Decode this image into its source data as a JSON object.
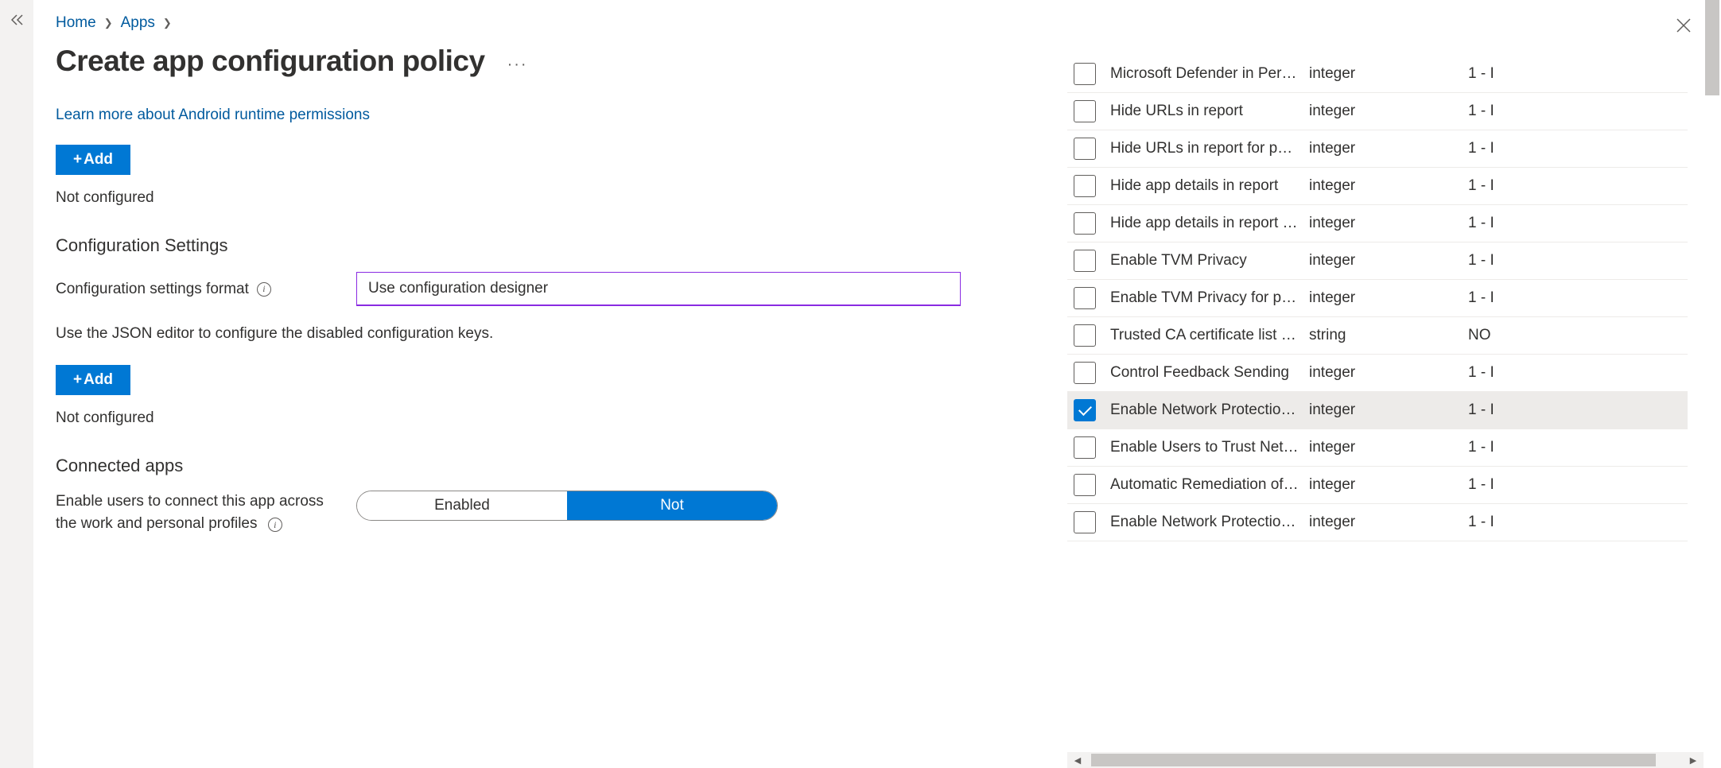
{
  "breadcrumb": {
    "home": "Home",
    "apps": "Apps"
  },
  "page": {
    "title": "Create app configuration policy",
    "more": "···",
    "learn_link": "Learn more about Android runtime permissions",
    "add_label": "Add",
    "not_configured": "Not configured",
    "config_head": "Configuration Settings",
    "format_label": "Configuration settings format",
    "format_value": "Use configuration designer",
    "json_hint": "Use the JSON editor to configure the disabled configuration keys.",
    "connected_head": "Connected apps",
    "connected_hint": "Enable users to connect this app across the work and personal profiles",
    "toggle_enabled": "Enabled",
    "toggle_not": "Not"
  },
  "panel": {
    "rows": [
      {
        "key": "Microsoft Defender in Perso…",
        "type": "integer",
        "val": "1 - I",
        "checked": false
      },
      {
        "key": "Hide URLs in report",
        "type": "integer",
        "val": "1 - I",
        "checked": false
      },
      {
        "key": "Hide URLs in report for pers…",
        "type": "integer",
        "val": "1 - I",
        "checked": false
      },
      {
        "key": "Hide app details in report",
        "type": "integer",
        "val": "1 - I",
        "checked": false
      },
      {
        "key": "Hide app details in report f…",
        "type": "integer",
        "val": "1 - I",
        "checked": false
      },
      {
        "key": "Enable TVM Privacy",
        "type": "integer",
        "val": "1 - I",
        "checked": false
      },
      {
        "key": "Enable TVM Privacy for pers…",
        "type": "integer",
        "val": "1 - I",
        "checked": false
      },
      {
        "key": "Trusted CA certificate list for…",
        "type": "string",
        "val": "NO",
        "checked": false
      },
      {
        "key": "Control Feedback Sending",
        "type": "integer",
        "val": "1 - I",
        "checked": false
      },
      {
        "key": "Enable Network Protection i…",
        "type": "integer",
        "val": "1 - I",
        "checked": true
      },
      {
        "key": "Enable Users to Trust Netwo…",
        "type": "integer",
        "val": "1 - I",
        "checked": false
      },
      {
        "key": "Automatic Remediation of …",
        "type": "integer",
        "val": "1 - I",
        "checked": false
      },
      {
        "key": "Enable Network Protection …",
        "type": "integer",
        "val": "1 - I",
        "checked": false
      }
    ]
  }
}
